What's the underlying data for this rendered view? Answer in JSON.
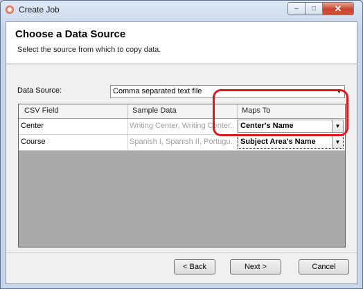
{
  "window": {
    "title": "Create Job",
    "controls": {
      "minimize": "–",
      "maximize": "□",
      "close": "✕"
    }
  },
  "header": {
    "title": "Choose a Data Source",
    "subtitle": "Select the source from which to copy data."
  },
  "data_source": {
    "label": "Data Source:",
    "value": "Comma separated text file"
  },
  "grid": {
    "columns": [
      "CSV Field",
      "Sample Data",
      "Maps To"
    ],
    "rows": [
      {
        "field": "Center",
        "sample": "Writing Center, Writing Center...",
        "maps_to": "Center's Name"
      },
      {
        "field": "Course",
        "sample": "Spanish I, Spanish II, Portugu...",
        "maps_to": "Subject Area's Name"
      }
    ]
  },
  "buttons": {
    "back": "< Back",
    "next": "Next >",
    "cancel": "Cancel"
  },
  "colors": {
    "highlight": "#e0161a",
    "grid_empty": "#aaaaaa",
    "client_bg": "#f0f0f0"
  },
  "icons": {
    "dropdown": "▼"
  }
}
